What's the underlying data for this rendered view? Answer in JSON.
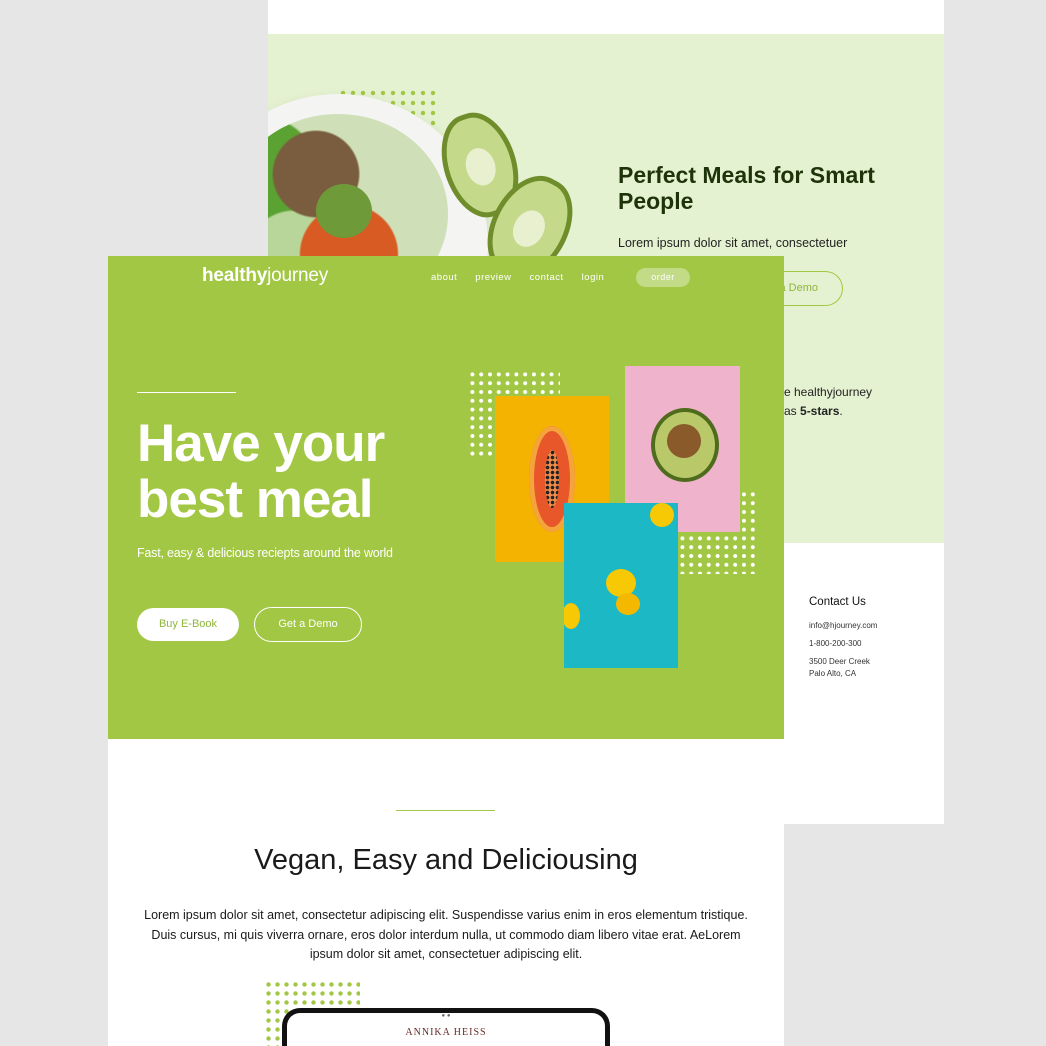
{
  "brand": {
    "bold": "healthy",
    "light": "journey"
  },
  "nav": {
    "items": [
      "about",
      "preview",
      "contact",
      "login"
    ],
    "cta": "order"
  },
  "hero": {
    "title": "Have your best meal",
    "subtitle": "Fast, easy & delicious reciepts around the world",
    "primary_button": "Buy E-Book",
    "secondary_button": "Get a Demo"
  },
  "section": {
    "title": "Vegan, Easy and Deliciousing",
    "body": "Lorem ipsum dolor sit amet, consectetur adipiscing elit. Suspendisse varius enim in eros elementum tristique. Duis cursus, mi quis viverra ornare, eros dolor interdum nulla, ut commodo diam libero vitae erat. AeLorem ipsum dolor sit amet, consectetuer adipiscing elit.",
    "tablet_name": "ANNIKA HEISS"
  },
  "back_page": {
    "title": "Perfect Meals for Smart People",
    "text": "Lorem ipsum dolor sit amet, consectetuer",
    "demo_button_visible": "a Demo",
    "quote_line1": "e healthyjourney",
    "quote_line2_prefix": "as ",
    "quote_line2_bold": "5-stars",
    "quote_line2_suffix": "."
  },
  "contact": {
    "title": "Contact Us",
    "email": "info@hjourney.com",
    "phone": "1-800-200-300",
    "address_line1": "3500 Deer Creek",
    "address_line2": "Palo Alto, CA"
  },
  "colors": {
    "accent": "#a2c744",
    "light_green": "#e5f2d1",
    "dark_green": "#1e3309"
  }
}
